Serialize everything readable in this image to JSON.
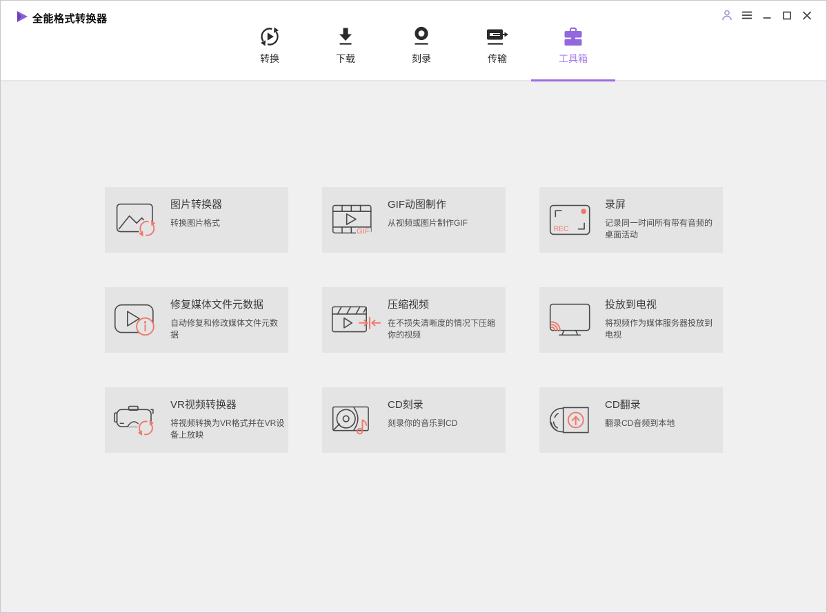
{
  "window": {
    "title": "全能格式转换器",
    "controls": {
      "account": "account",
      "menu": "menu",
      "minimize": "minimize",
      "maximize": "maximize",
      "close": "close"
    }
  },
  "nav": {
    "tabs": [
      {
        "label": "转换",
        "icon": "convert-icon",
        "active": false
      },
      {
        "label": "下载",
        "icon": "download-icon",
        "active": false
      },
      {
        "label": "刻录",
        "icon": "burn-icon",
        "active": false
      },
      {
        "label": "传输",
        "icon": "transfer-icon",
        "active": false
      },
      {
        "label": "工具箱",
        "icon": "toolbox-icon",
        "active": true
      }
    ]
  },
  "toolbox": {
    "cards": [
      {
        "title": "图片转换器",
        "desc": "转换图片格式",
        "icon": "image-converter-icon"
      },
      {
        "title": "GIF动图制作",
        "desc": "从视频或图片制作GIF",
        "icon": "gif-maker-icon"
      },
      {
        "title": "录屏",
        "desc": "记录同一时间所有带有音频的桌面活动",
        "icon": "screen-record-icon"
      },
      {
        "title": "修复媒体文件元数据",
        "desc": "自动修复和修改媒体文件元数据",
        "icon": "fix-metadata-icon"
      },
      {
        "title": "压缩视频",
        "desc": "在不损失清晰度的情况下压缩你的视频",
        "icon": "compress-video-icon"
      },
      {
        "title": "投放到电视",
        "desc": "将视频作为媒体服务器投放到电视",
        "icon": "cast-to-tv-icon"
      },
      {
        "title": "VR视频转换器",
        "desc": "将视频转换为VR格式并在VR设备上放映",
        "icon": "vr-converter-icon"
      },
      {
        "title": "CD刻录",
        "desc": "刻录你的音乐到CD",
        "icon": "cd-burn-icon"
      },
      {
        "title": "CD翻录",
        "desc": "翻录CD音频到本地",
        "icon": "cd-rip-icon"
      }
    ]
  },
  "icon_labels": {
    "rec": "REC",
    "gif": "GIF"
  },
  "colors": {
    "accent_purple": "#9b6ce0",
    "accent_purple_light": "#a67fe8",
    "accent_coral": "#f0776b",
    "header_bg": "#ffffff",
    "content_bg": "#f0f0f0",
    "card_bg": "#e4e4e4",
    "tab_ink": "#2b2b2b"
  }
}
